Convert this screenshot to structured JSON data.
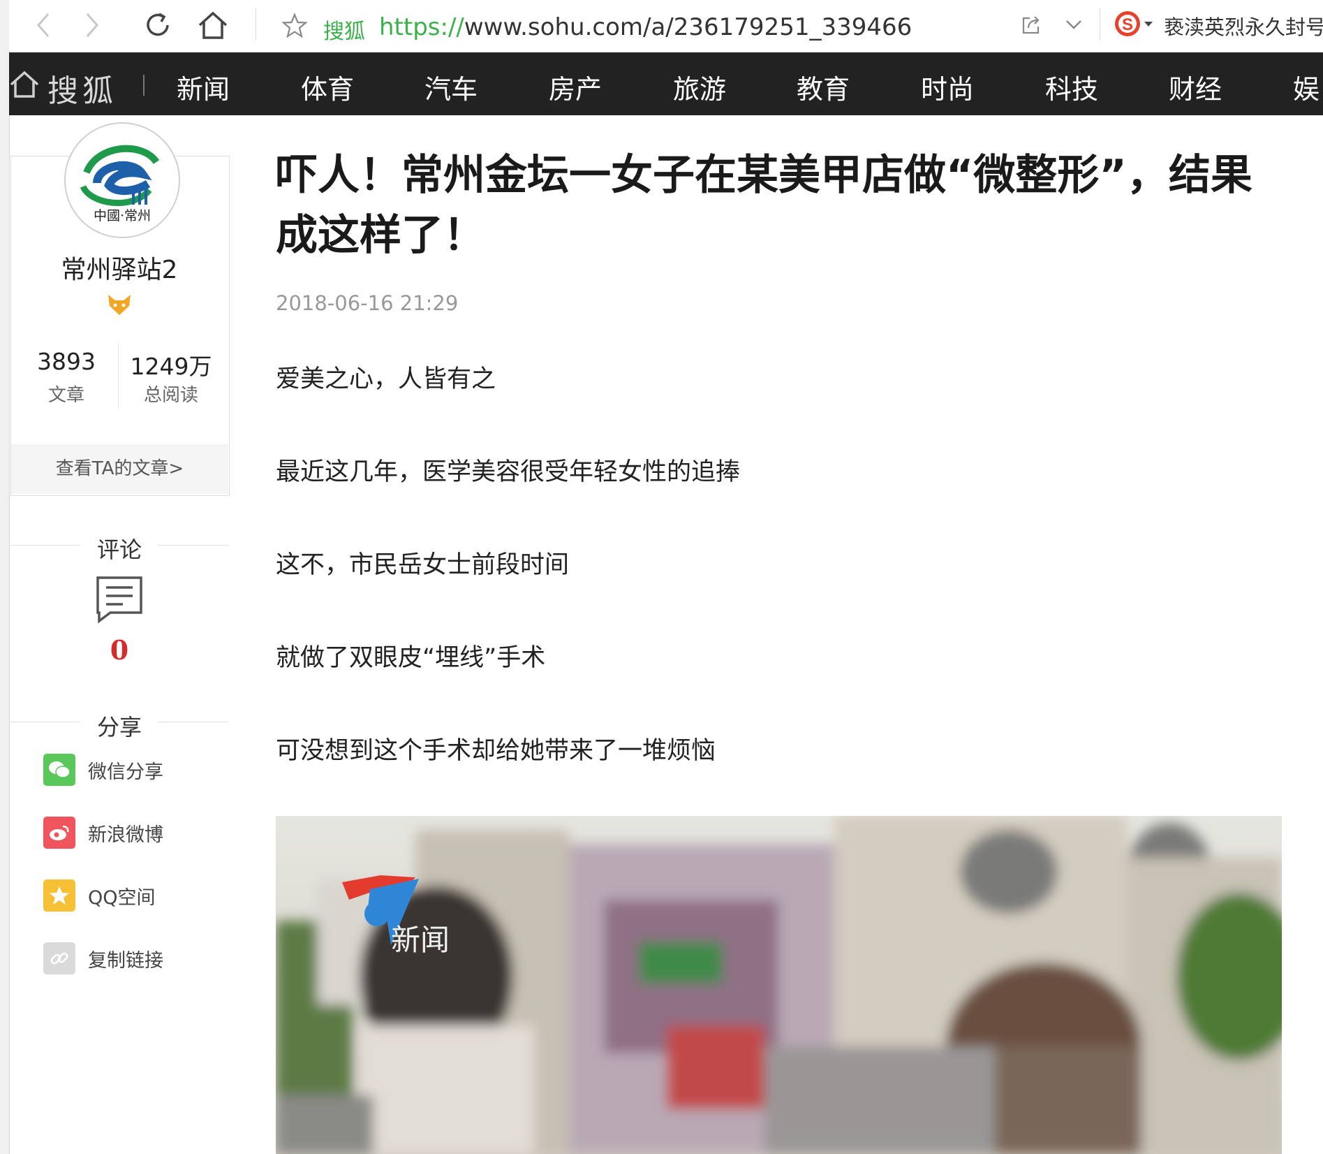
{
  "browser": {
    "site_label": "搜狐",
    "url_scheme": "https://",
    "url_rest": "www.sohu.com/a/236179251_339466",
    "search_hint": "亵渎英烈永久封号"
  },
  "nav": {
    "logo": "搜狐",
    "items": [
      "新闻",
      "体育",
      "汽车",
      "房产",
      "旅游",
      "教育",
      "时尚",
      "科技",
      "财经",
      "娱"
    ]
  },
  "author": {
    "avatar_caption": "中國·常州",
    "name": "常州驿站2",
    "stats": [
      {
        "value": "3893",
        "label": "文章"
      },
      {
        "value": "1249万",
        "label": "总阅读"
      }
    ],
    "view_articles": "查看TA的文章>"
  },
  "comment": {
    "title": "评论",
    "count": "0"
  },
  "share": {
    "title": "分享",
    "items": [
      {
        "label": "微信分享",
        "icon": "wechat-icon",
        "color": "#5ac75a"
      },
      {
        "label": "新浪微博",
        "icon": "weibo-icon",
        "color": "#f0545c"
      },
      {
        "label": "QQ空间",
        "icon": "qzone-icon",
        "color": "#f7c136"
      },
      {
        "label": "复制链接",
        "icon": "link-icon",
        "color": "#dadada"
      }
    ]
  },
  "article": {
    "title": "吓人！常州金坛一女子在某美甲店做“微整形”，结果成这样了！",
    "date": "2018-06-16 21:29",
    "paragraphs": [
      "爱美之心，人皆有之",
      "最近这几年，医学美容很受年轻女性的追捧",
      "这不，市民岳女士前段时间",
      "就做了双眼皮“埋线”手术",
      "可没想到这个手术却给她带来了一堆烦恼"
    ],
    "photo_watermark": "新闻"
  },
  "colors": {
    "nav_bg": "#222222",
    "url_green": "#3bb14a",
    "comment_red": "#d42b2b"
  }
}
